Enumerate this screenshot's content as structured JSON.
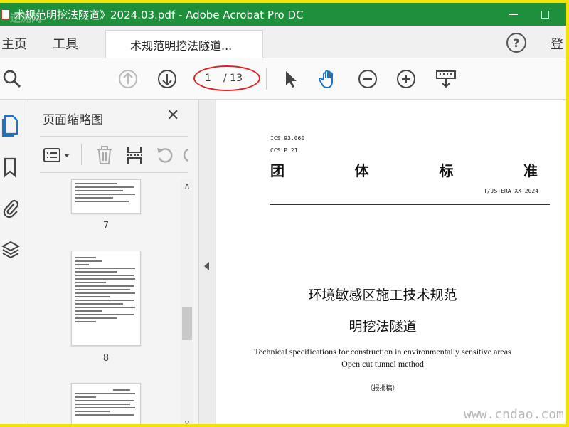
{
  "window": {
    "title": "术规范明挖法隧道》2024.03.pdf - Adobe Acrobat Pro DC",
    "watermark_topleft": "逆溯网"
  },
  "tabs": {
    "home": "主页",
    "tools": "工具",
    "document": "术规范明挖法隧道...",
    "signin": "登",
    "help": "?"
  },
  "toolbar": {
    "current_page": "1",
    "total_pages": "/ 13"
  },
  "thumbnail_panel": {
    "title": "页面缩略图",
    "close": "✕",
    "pages": [
      {
        "number": "7"
      },
      {
        "number": "8"
      }
    ]
  },
  "document": {
    "ics": "ICS 93.060",
    "ccs": "CCS P 21",
    "header_chars": [
      "团",
      "体",
      "标",
      "准"
    ],
    "standard_no": "T/JSTERA XX—2024",
    "title_cn_1": "环境敏感区施工技术规范",
    "title_cn_2": "明挖法隧道",
    "title_en_1": "Technical specifications for construction in environmentally sensitive areas",
    "title_en_2": "Open cut tunnel method",
    "draft": "（报批稿）"
  },
  "watermark": "www.cndao.com",
  "colors": {
    "titlebar": "#1e8f3a",
    "frame": "#f2e300",
    "annotation_oval": "#e02020",
    "active_icon": "#1a73c9"
  }
}
